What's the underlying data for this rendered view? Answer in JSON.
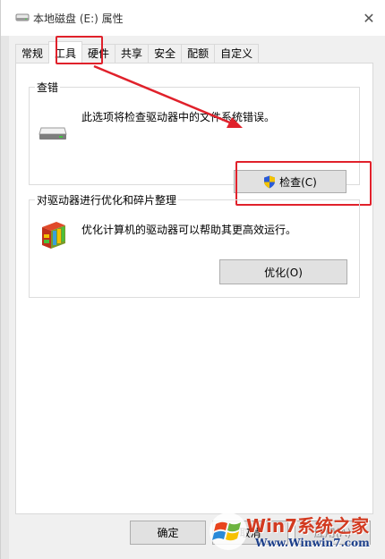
{
  "window": {
    "title": "本地磁盘 (E:) 属性",
    "close_glyph": "✕"
  },
  "tabs": [
    {
      "label": "常规",
      "active": false
    },
    {
      "label": "工具",
      "active": true
    },
    {
      "label": "硬件",
      "active": false
    },
    {
      "label": "共享",
      "active": false
    },
    {
      "label": "安全",
      "active": false
    },
    {
      "label": "配额",
      "active": false
    },
    {
      "label": "自定义",
      "active": false
    }
  ],
  "error_check": {
    "title": "查错",
    "description": "此选项将检查驱动器中的文件系统错误。",
    "button_label": "检查(C)",
    "icon": "drive-icon",
    "button_icon": "uac-shield-icon"
  },
  "optimize": {
    "title": "对驱动器进行优化和碎片整理",
    "description": "优化计算机的驱动器可以帮助其更高效运行。",
    "button_label": "优化(O)",
    "icon": "defrag-icon"
  },
  "footer": {
    "ok_label": "确定",
    "cancel_label": "取消",
    "apply_label": "应用(A)"
  },
  "watermark": {
    "brand": "Win7系统之家",
    "url": "Www.Winwin7.com"
  },
  "colors": {
    "highlight": "#e0212b",
    "panel_bg": "#ffffff",
    "window_bg": "#f0f0f0"
  }
}
